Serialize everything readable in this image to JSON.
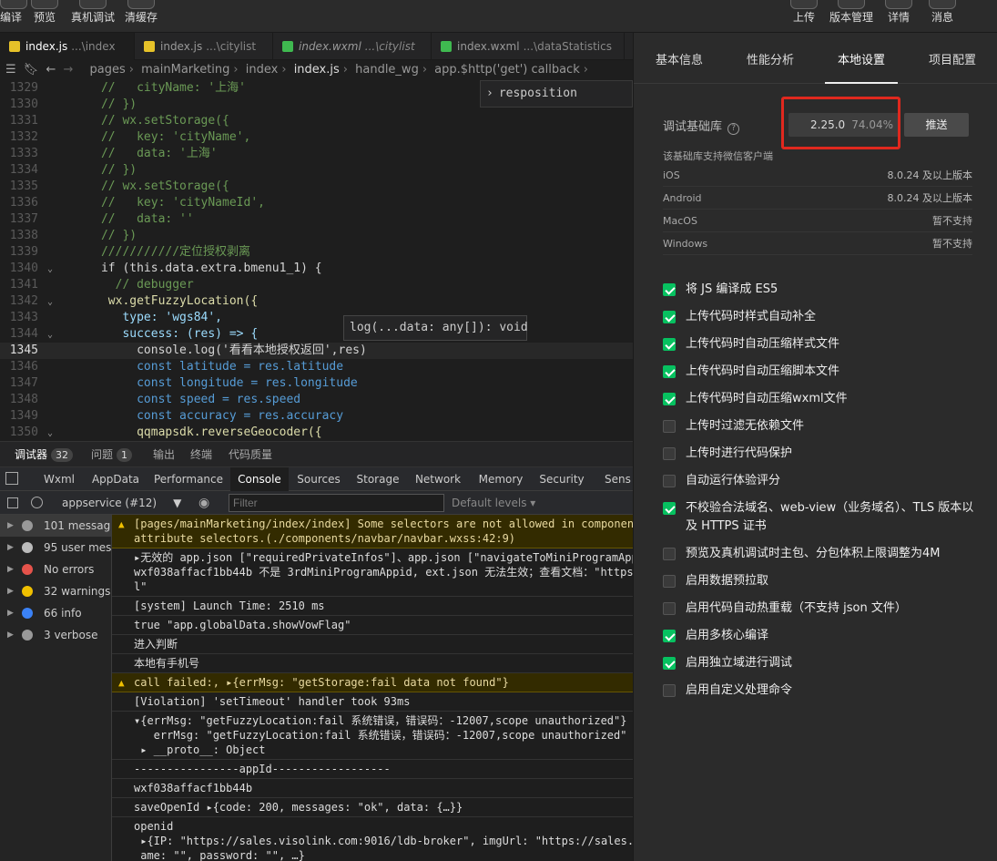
{
  "toolbar": {
    "left": [
      "编译",
      "预览",
      "真机调试",
      "清缓存"
    ],
    "right": [
      "上传",
      "版本管理",
      "详情",
      "消息"
    ]
  },
  "editor": {
    "tabs": [
      {
        "name": "index.js",
        "path": "...\\index",
        "color": "#e6c229"
      },
      {
        "name": "index.js",
        "path": "...\\citylist",
        "color": "#e6c229"
      },
      {
        "name": "index.wxml",
        "path": "...\\citylist",
        "color": "#3fb950"
      },
      {
        "name": "index.wxml",
        "path": "...\\dataStatistics",
        "color": "#3fb950"
      }
    ],
    "breadcrumb": [
      "pages",
      "mainMarketing",
      "index",
      "index.js",
      "handle_wg",
      "app.$http('get') callback"
    ],
    "autocomplete": "resposition",
    "hover": "log(...data: any[]): void",
    "lines": [
      {
        "n": "1329",
        "t": "      //   cityName: '上海'",
        "k": "com"
      },
      {
        "n": "1330",
        "t": "      // })",
        "k": "com"
      },
      {
        "n": "1331",
        "t": "      // wx.setStorage({",
        "k": "com"
      },
      {
        "n": "1332",
        "t": "      //   key: 'cityName',",
        "k": "com"
      },
      {
        "n": "1333",
        "t": "      //   data: '上海'",
        "k": "com"
      },
      {
        "n": "1334",
        "t": "      // })",
        "k": "com"
      },
      {
        "n": "1335",
        "t": "      // wx.setStorage({",
        "k": "com"
      },
      {
        "n": "1336",
        "t": "      //   key: 'cityNameId',",
        "k": "com"
      },
      {
        "n": "1337",
        "t": "      //   data: ''",
        "k": "com"
      },
      {
        "n": "1338",
        "t": "      // })",
        "k": "com"
      },
      {
        "n": "1339",
        "t": "      ///////////定位授权剥离",
        "k": "com"
      },
      {
        "n": "1340",
        "t": "      if (this.data.extra.bmenu1_1) {",
        "k": "plain",
        "fold": true
      },
      {
        "n": "1341",
        "t": "        // debugger",
        "k": "com"
      },
      {
        "n": "1342",
        "t": "       wx.getFuzzyLocation({",
        "k": "fn",
        "fold": true
      },
      {
        "n": "1343",
        "t": "         type: 'wgs84',",
        "k": "prop"
      },
      {
        "n": "1344",
        "t": "         success: (res) => {",
        "k": "prop",
        "fold": true
      },
      {
        "n": "1345",
        "t": "           console.log('看看本地授权返回',res)",
        "k": "plain",
        "cur": true
      },
      {
        "n": "1346",
        "t": "           const latitude = res.latitude",
        "k": "kw"
      },
      {
        "n": "1347",
        "t": "           const longitude = res.longitude",
        "k": "kw"
      },
      {
        "n": "1348",
        "t": "           const speed = res.speed",
        "k": "kw"
      },
      {
        "n": "1349",
        "t": "           const accuracy = res.accuracy",
        "k": "kw"
      },
      {
        "n": "1350",
        "t": "           qqmapsdk.reverseGeocoder({",
        "k": "fn",
        "fold": true
      }
    ]
  },
  "debugger": {
    "tabs": [
      {
        "label": "调试器",
        "badge": "32"
      },
      {
        "label": "问题",
        "badge": "1"
      },
      {
        "label": "输出",
        "badge": ""
      },
      {
        "label": "终端",
        "badge": ""
      },
      {
        "label": "代码质量",
        "badge": ""
      }
    ],
    "panels": [
      "Wxml",
      "AppData",
      "Performance",
      "Console",
      "Sources",
      "Storage",
      "Network",
      "Memory",
      "Security",
      "Sens"
    ],
    "context": "appservice (#12)",
    "filter_placeholder": "Filter",
    "levels": "Default levels",
    "sidebar": [
      {
        "label": "101 messag...",
        "color": "#999"
      },
      {
        "label": "95 user mes...",
        "color": "#bbb"
      },
      {
        "label": "No errors",
        "color": "#e5534b"
      },
      {
        "label": "32 warnings",
        "color": "#f0c000"
      },
      {
        "label": "66 info",
        "color": "#3b82f6"
      },
      {
        "label": "3 verbose",
        "color": "#999"
      }
    ],
    "logs": [
      {
        "warn": true,
        "text": "[pages/mainMarketing/index/index] Some selectors are not allowed in component wxss,\nattribute selectors.(./components/navbar/navbar.wxss:42:9)"
      },
      {
        "warn": false,
        "text": "▸无效的 app.json [\"requiredPrivateInfos\"]、app.json [\"navigateToMiniProgramAppIdList\nwxf038affacf1bb44b 不是 3rdMiniProgramAppid, ext.json 无法生效；查看文档：\"https://de\nl\""
      },
      {
        "warn": false,
        "text": "[system] Launch Time: 2510 ms"
      },
      {
        "warn": false,
        "text": "true \"app.globalData.showVowFlag\""
      },
      {
        "warn": false,
        "text": "进入判断"
      },
      {
        "warn": false,
        "text": "本地有手机号"
      },
      {
        "warn": true,
        "text": "call failed:, ▸{errMsg: \"getStorage:fail data not found\"}"
      },
      {
        "warn": false,
        "text": "[Violation] 'setTimeout' handler took 93ms"
      },
      {
        "warn": false,
        "text": "▾{errMsg: \"getFuzzyLocation:fail 系统错误，错误码：-12007,scope unauthorized\"}  \"\n   errMsg: \"getFuzzyLocation:fail 系统错误，错误码：-12007,scope unauthorized\"\n ▸ __proto__: Object"
      },
      {
        "warn": false,
        "text": "----------------appId------------------"
      },
      {
        "warn": false,
        "text": "wxf038affacf1bb44b"
      },
      {
        "warn": false,
        "text": "saveOpenId ▸{code: 200, messages: \"ok\", data: {…}}"
      },
      {
        "warn": false,
        "text": "openid\n ▸{IP: \"https://sales.visolink.com:9016/ldb-broker\", imgUrl: \"https://sales.visolin\n ame: \"\", password: \"\", …}\n<<<<<<<<<<<<"
      }
    ]
  },
  "settings": {
    "tabs": [
      "基本信息",
      "性能分析",
      "本地设置",
      "项目配置"
    ],
    "lib_label": "调试基础库",
    "lib_version": "2.25.0",
    "lib_percent": "74.04%",
    "push": "推送",
    "support_title": "该基础库支持微信客户端",
    "support": [
      {
        "os": "iOS",
        "v": "8.0.24 及以上版本"
      },
      {
        "os": "Android",
        "v": "8.0.24 及以上版本"
      },
      {
        "os": "MacOS",
        "v": "暂不支持"
      },
      {
        "os": "Windows",
        "v": "暂不支持"
      }
    ],
    "options": [
      {
        "label": "将 JS 编译成 ES5",
        "on": true
      },
      {
        "label": "上传代码时样式自动补全",
        "on": true
      },
      {
        "label": "上传代码时自动压缩样式文件",
        "on": true
      },
      {
        "label": "上传代码时自动压缩脚本文件",
        "on": true
      },
      {
        "label": "上传代码时自动压缩wxml文件",
        "on": true
      },
      {
        "label": "上传时过滤无依赖文件",
        "on": false
      },
      {
        "label": "上传时进行代码保护",
        "on": false
      },
      {
        "label": "自动运行体验评分",
        "on": false
      },
      {
        "label": "不校验合法域名、web-view（业务域名）、TLS 版本以及 HTTPS 证书",
        "on": true
      },
      {
        "label": "预览及真机调试时主包、分包体积上限调整为4M",
        "on": false
      },
      {
        "label": "启用数据预拉取",
        "on": false
      },
      {
        "label": "启用代码自动热重载（不支持 json 文件）",
        "on": false
      },
      {
        "label": "启用多核心编译",
        "on": true
      },
      {
        "label": "启用独立域进行调试",
        "on": true
      },
      {
        "label": "启用自定义处理命令",
        "on": false
      }
    ]
  }
}
